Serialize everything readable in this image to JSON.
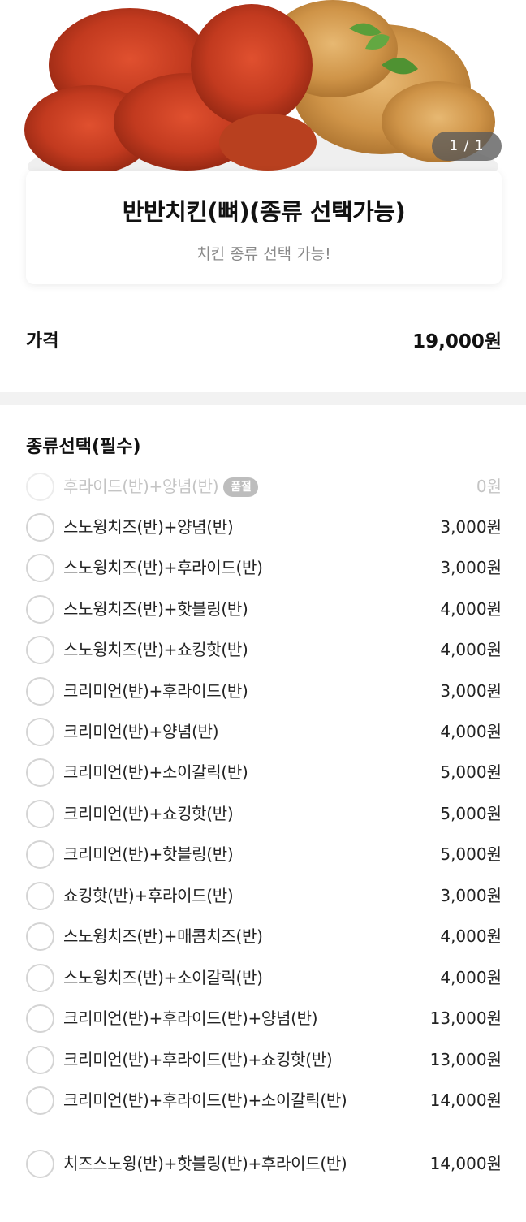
{
  "hero": {
    "image_alt": "fried chicken half and half photo",
    "pager": "1 / 1"
  },
  "product": {
    "title": "반반치킨(뼈)(종류 선택가능)",
    "subtitle": "치킨 종류 선택 가능!"
  },
  "price": {
    "label": "가격",
    "value": "19,000원"
  },
  "options_section": {
    "title": "종류선택(필수)",
    "items": [
      {
        "label": "후라이드(반)+양념(반)",
        "price": "0원",
        "sold_out": true,
        "badge": "품절"
      },
      {
        "label": "스노윙치즈(반)+양념(반)",
        "price": "3,000원"
      },
      {
        "label": "스노윙치즈(반)+후라이드(반)",
        "price": "3,000원"
      },
      {
        "label": "스노윙치즈(반)+핫블링(반)",
        "price": "4,000원"
      },
      {
        "label": "스노윙치즈(반)+쇼킹핫(반)",
        "price": "4,000원"
      },
      {
        "label": "크리미언(반)+후라이드(반)",
        "price": "3,000원"
      },
      {
        "label": "크리미언(반)+양념(반)",
        "price": "4,000원"
      },
      {
        "label": "크리미언(반)+소이갈릭(반)",
        "price": "5,000원"
      },
      {
        "label": "크리미언(반)+쇼킹핫(반)",
        "price": "5,000원"
      },
      {
        "label": "크리미언(반)+핫블링(반)",
        "price": "5,000원"
      },
      {
        "label": "쇼킹핫(반)+후라이드(반)",
        "price": "3,000원"
      },
      {
        "label": "스노윙치즈(반)+매콤치즈(반)",
        "price": "4,000원"
      },
      {
        "label": "스노윙치즈(반)+소이갈릭(반)",
        "price": "4,000원"
      },
      {
        "label": "크리미언(반)+후라이드(반)+양념(반)",
        "price": "13,000원"
      },
      {
        "label": "크리미언(반)+후라이드(반)+쇼킹핫(반)",
        "price": "13,000원"
      },
      {
        "label": "크리미언(반)+후라이드(반)+소이갈릭(반)",
        "price": "14,000원"
      },
      {
        "label": "치즈스노윙(반)+핫블링(반)+후라이드(반)",
        "price": "14,000원"
      }
    ]
  }
}
